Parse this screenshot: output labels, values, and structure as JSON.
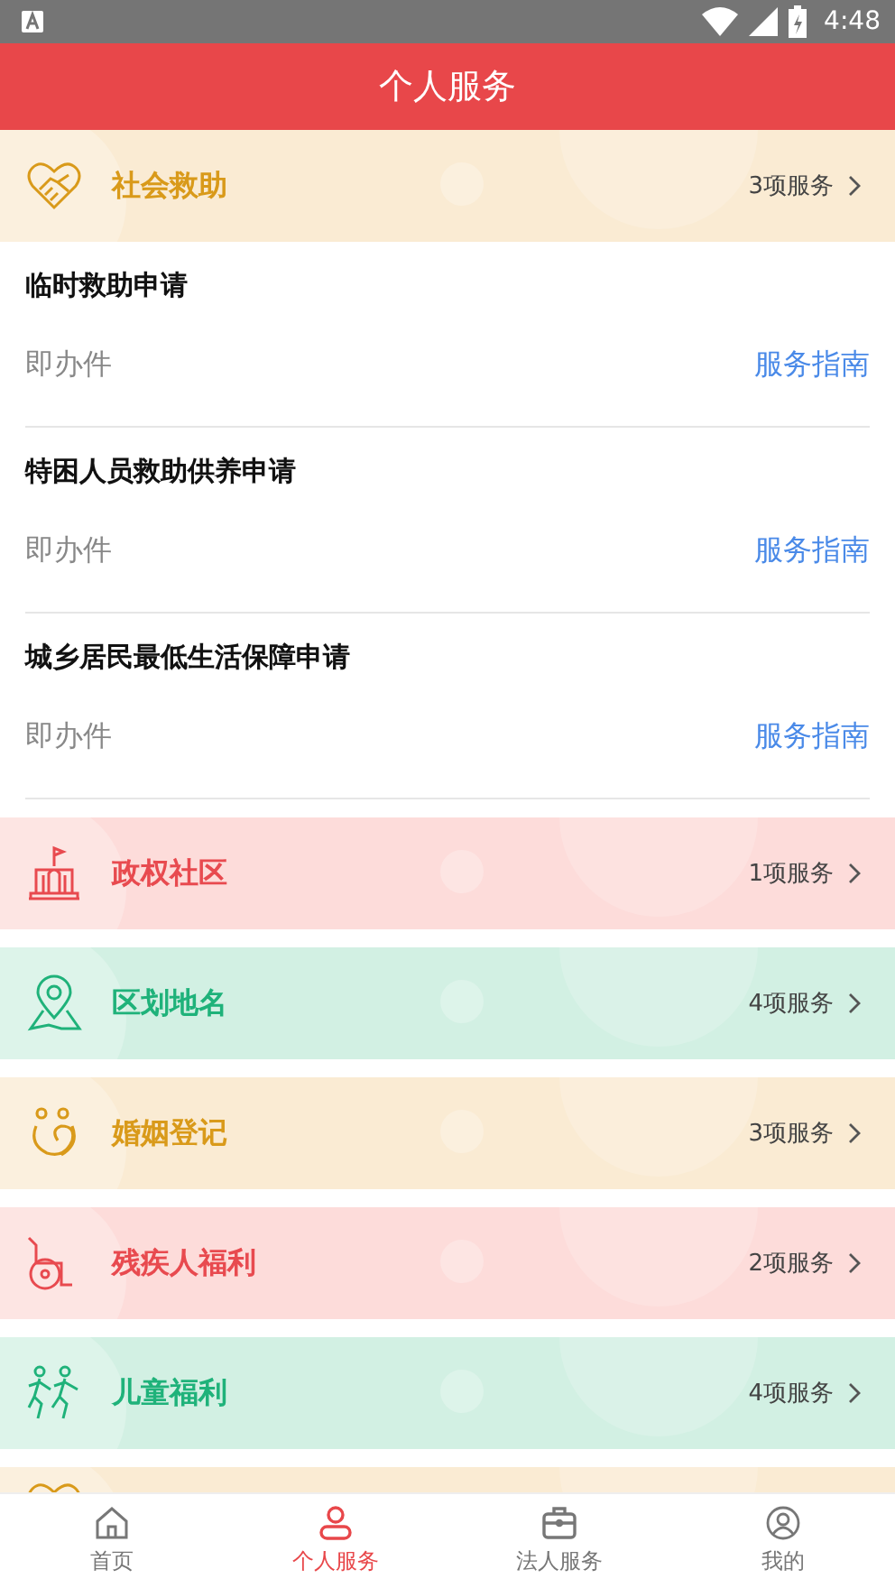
{
  "status_bar": {
    "time": "4:48"
  },
  "header": {
    "title": "个人服务"
  },
  "categories": [
    {
      "kind": "handshake",
      "color": "#d99a1a",
      "title": "社会救助",
      "count": "3项服务",
      "services": [
        {
          "name": "临时救助申请",
          "type": "即办件",
          "link": "服务指南"
        },
        {
          "name": "特困人员救助供养申请",
          "type": "即办件",
          "link": "服务指南"
        },
        {
          "name": "城乡居民最低生活保障申请",
          "type": "即办件",
          "link": "服务指南"
        }
      ]
    },
    {
      "kind": "building",
      "color": "#e84a4f",
      "title": "政权社区",
      "count": "1项服务"
    },
    {
      "kind": "pin",
      "color": "#1fb27a",
      "title": "区划地名",
      "count": "4项服务"
    },
    {
      "kind": "rings",
      "color": "#d99a1a",
      "title": "婚姻登记",
      "count": "3项服务"
    },
    {
      "kind": "wheelchair",
      "color": "#e84a4f",
      "title": "残疾人福利",
      "count": "2项服务"
    },
    {
      "kind": "runners",
      "color": "#1fb27a",
      "title": "儿童福利",
      "count": "4项服务"
    },
    {
      "kind": "handshake",
      "color": "#d99a1a"
    }
  ],
  "tabs": [
    {
      "kind": "home",
      "label": "首页",
      "selected": false
    },
    {
      "kind": "person",
      "label": "个人服务",
      "selected": true
    },
    {
      "kind": "briefcase",
      "label": "法人服务",
      "selected": false
    },
    {
      "kind": "user-circle",
      "label": "我的",
      "selected": false
    }
  ]
}
